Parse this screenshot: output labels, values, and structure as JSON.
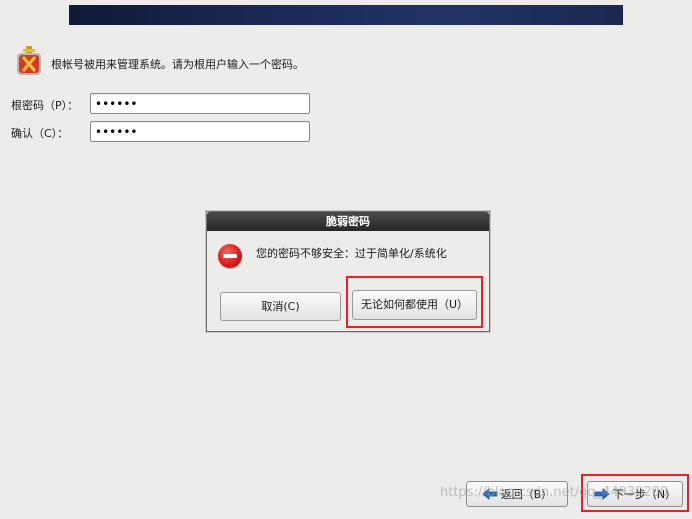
{
  "intro_text": "根帐号被用来管理系统。请为根用户输入一个密码。",
  "fields": {
    "root_password_label": "根密码（P）：",
    "root_password_value": "••••••",
    "confirm_label": "确认（C）：",
    "confirm_value": "••••••"
  },
  "dialog": {
    "title": "脆弱密码",
    "message": "您的密码不够安全：过于简单化/系统化",
    "cancel_label": "取消(C)",
    "use_anyway_label": "无论如何都使用（U）"
  },
  "nav": {
    "back_label": "返回（B）",
    "next_label": "下一步（N）"
  },
  "watermark": "https://blog.csdn.net/qq_44939200",
  "colors": {
    "background": "#edeceb",
    "banner": "#1d2c5c",
    "highlight": "#e8202a",
    "error_icon": "#d81f1f",
    "arrow_blue": "#2a6fc9"
  }
}
